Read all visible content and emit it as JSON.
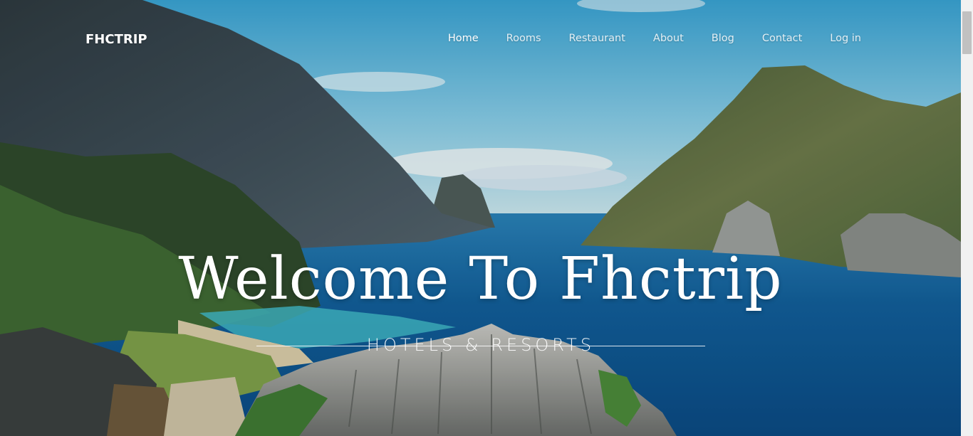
{
  "brand": {
    "logo": "FHCTRIP"
  },
  "nav": {
    "items": [
      {
        "label": "Home",
        "active": true
      },
      {
        "label": "Rooms",
        "active": false
      },
      {
        "label": "Restaurant",
        "active": false
      },
      {
        "label": "About",
        "active": false
      },
      {
        "label": "Blog",
        "active": false
      },
      {
        "label": "Contact",
        "active": false
      },
      {
        "label": "Log in",
        "active": false
      }
    ]
  },
  "hero": {
    "title": "Welcome To Fhctrip",
    "subtitle": "HOTELS & RESORTS",
    "background": "tropical-lagoon-photo"
  },
  "colors": {
    "text": "#ffffff",
    "sea": "#0f5e9a",
    "sky": "#63c0e2"
  }
}
